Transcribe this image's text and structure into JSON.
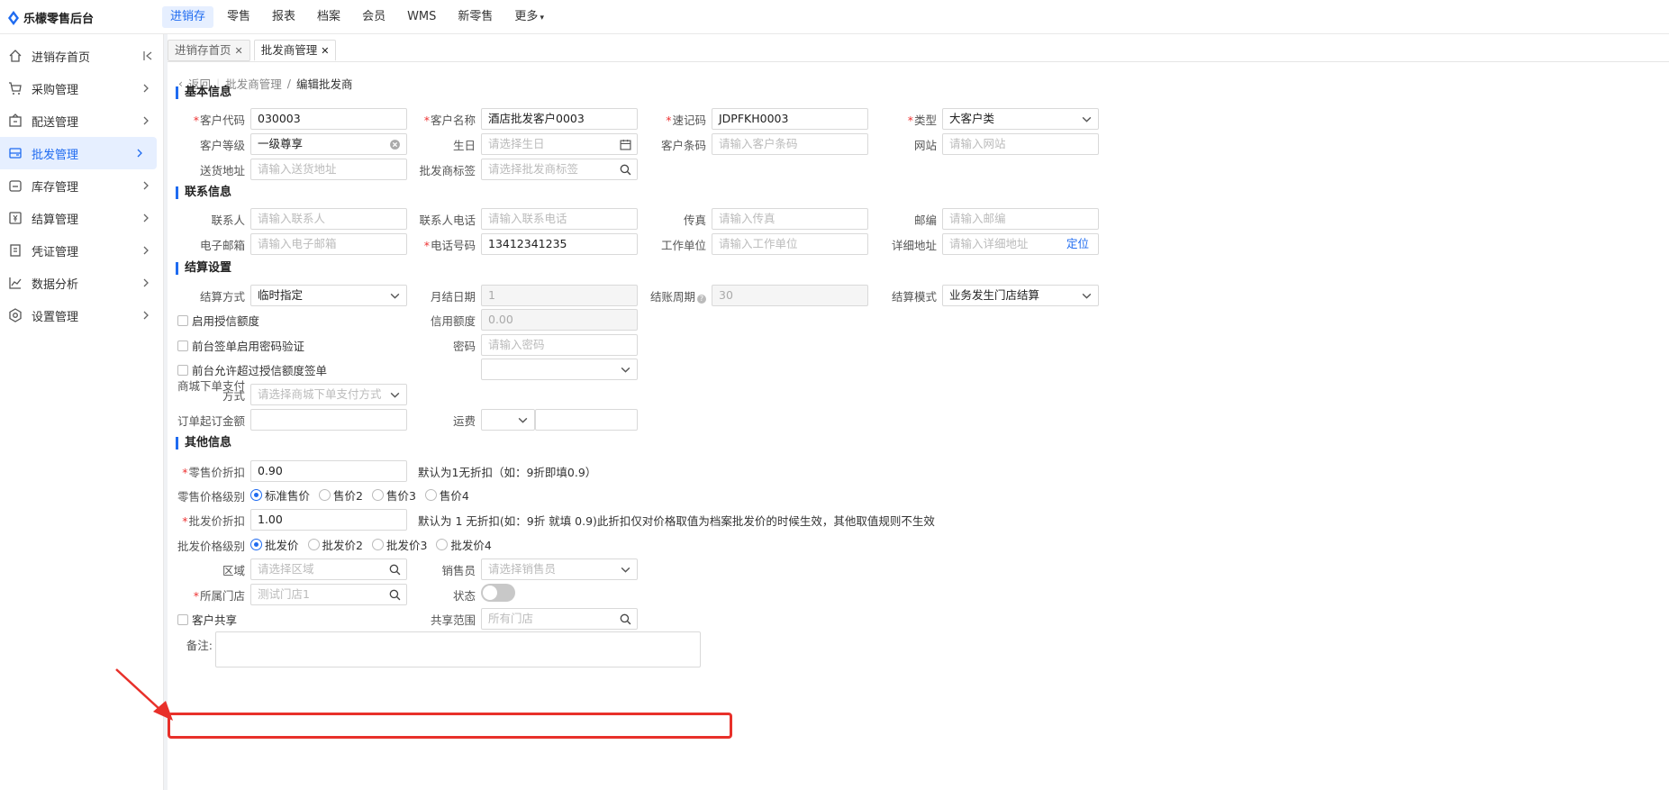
{
  "app": {
    "title": "乐檬零售后台"
  },
  "nav": [
    "进销存",
    "零售",
    "报表",
    "档案",
    "会员",
    "WMS",
    "新零售",
    "更多"
  ],
  "sidebar": [
    {
      "label": "进销存首页",
      "icon": "home-icon"
    },
    {
      "label": "采购管理",
      "icon": "cart-icon"
    },
    {
      "label": "配送管理",
      "icon": "box-icon"
    },
    {
      "label": "批发管理",
      "icon": "wholesale-icon"
    },
    {
      "label": "库存管理",
      "icon": "inventory-icon"
    },
    {
      "label": "结算管理",
      "icon": "settlement-icon"
    },
    {
      "label": "凭证管理",
      "icon": "voucher-icon"
    },
    {
      "label": "数据分析",
      "icon": "chart-icon"
    },
    {
      "label": "设置管理",
      "icon": "settings-icon"
    }
  ],
  "tabs": [
    {
      "label": "进销存首页"
    },
    {
      "label": "批发商管理"
    }
  ],
  "breadcrumb": {
    "back": "返回",
    "parent": "批发商管理",
    "sep": "/",
    "current": "编辑批发商"
  },
  "sections": {
    "basic": "基本信息",
    "contact": "联系信息",
    "settle": "结算设置",
    "other": "其他信息"
  },
  "basic": {
    "code": {
      "label": "客户代码",
      "value": "030003"
    },
    "name": {
      "label": "客户名称",
      "value": "酒店批发客户0003"
    },
    "quick": {
      "label": "速记码",
      "value": "JDPFKH0003"
    },
    "type": {
      "label": "类型",
      "value": "大客户类"
    },
    "level": {
      "label": "客户等级",
      "value": "一级尊享"
    },
    "birthday": {
      "label": "生日",
      "placeholder": "请选择生日"
    },
    "barcode": {
      "label": "客户条码",
      "placeholder": "请输入客户条码"
    },
    "website": {
      "label": "网站",
      "placeholder": "请输入网站"
    },
    "address": {
      "label": "送货地址",
      "placeholder": "请输入送货地址"
    },
    "tag": {
      "label": "批发商标签",
      "placeholder": "请选择批发商标签"
    }
  },
  "contact": {
    "person": {
      "label": "联系人",
      "placeholder": "请输入联系人"
    },
    "phone": {
      "label": "联系人电话",
      "placeholder": "请输入联系电话"
    },
    "fax": {
      "label": "传真",
      "placeholder": "请输入传真"
    },
    "zip": {
      "label": "邮编",
      "placeholder": "请输入邮编"
    },
    "email": {
      "label": "电子邮箱",
      "placeholder": "请输入电子邮箱"
    },
    "tel": {
      "label": "电话号码",
      "value": "13412341235"
    },
    "company": {
      "label": "工作单位",
      "placeholder": "请输入工作单位"
    },
    "detail": {
      "label": "详细地址",
      "placeholder": "请输入详细地址",
      "action": "定位"
    }
  },
  "settle": {
    "method": {
      "label": "结算方式",
      "value": "临时指定"
    },
    "monthday": {
      "label": "月结日期",
      "value": "1"
    },
    "period": {
      "label": "结账周期",
      "value": "30"
    },
    "mode": {
      "label": "结算模式",
      "value": "业务发生门店结算"
    },
    "credit_enable": "启用授信额度",
    "credit": {
      "label": "信用额度",
      "value": "0.00"
    },
    "pwd_check": "前台签单启用密码验证",
    "pwd": {
      "label": "密码",
      "placeholder": "请输入密码"
    },
    "over_credit": "前台允许超过授信额度签单",
    "mall_pay": {
      "label": "商城下单支付方式",
      "placeholder": "请选择商城下单支付方式"
    },
    "min_order": {
      "label": "订单起订金额"
    },
    "freight": {
      "label": "运费"
    }
  },
  "other": {
    "retail_disc": {
      "label": "零售价折扣",
      "value": "0.90",
      "hint": "默认为1无折扣（如：9折即填0.9）"
    },
    "retail_level": {
      "label": "零售价格级别",
      "options": [
        "标准售价",
        "售价2",
        "售价3",
        "售价4"
      ],
      "selected": 0
    },
    "whole_disc": {
      "label": "批发价折扣",
      "value": "1.00",
      "hint": "默认为 1 无折扣(如：9折 就填 0.9)此折扣仅对价格取值为档案批发价的时候生效，其他取值规则不生效"
    },
    "whole_level": {
      "label": "批发价格级别",
      "options": [
        "批发价",
        "批发价2",
        "批发价3",
        "批发价4"
      ],
      "selected": 0
    },
    "region": {
      "label": "区域",
      "placeholder": "请选择区域"
    },
    "sales": {
      "label": "销售员",
      "placeholder": "请选择销售员"
    },
    "store": {
      "label": "所属门店",
      "placeholder": "测试门店1"
    },
    "status": {
      "label": "状态",
      "on": false
    },
    "share": "客户共享",
    "share_range": {
      "label": "共享范围",
      "placeholder": "所有门店"
    },
    "remark": {
      "label": "备注:"
    }
  },
  "colors": {
    "accent": "#1f6bf0",
    "highlight": "#e8302a"
  }
}
